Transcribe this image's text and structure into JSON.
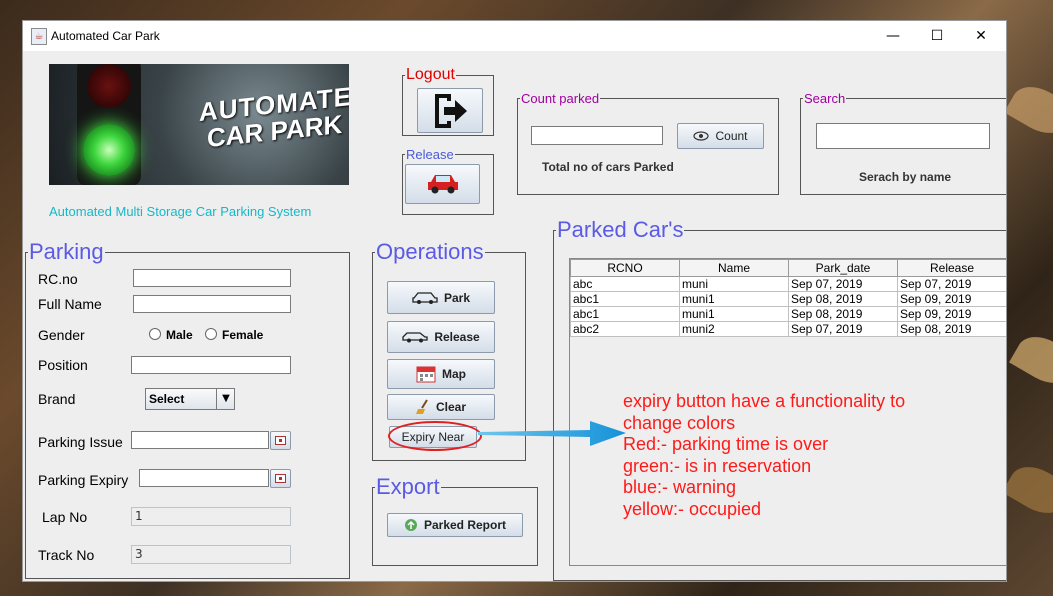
{
  "window": {
    "title": "Automated Car Park",
    "controls": [
      "—",
      "☐",
      "✕"
    ]
  },
  "banner": {
    "line1": "AUTOMATED",
    "line2": "CAR PARK"
  },
  "subtitle": "Automated Multi Storage Car Parking System",
  "logout": {
    "legend": "Logout"
  },
  "release_top": {
    "legend": "Release"
  },
  "count_panel": {
    "legend": "Count parked",
    "input_value": "",
    "button_label": "Count",
    "caption": "Total no of cars Parked"
  },
  "search_panel": {
    "legend": "Search",
    "input_value": "",
    "caption": "Serach by name"
  },
  "parking": {
    "legend": "Parking",
    "rcno_label": "RC.no",
    "rcno_value": "",
    "fullname_label": "Full Name",
    "fullname_value": "",
    "gender_label": "Gender",
    "male_label": "Male",
    "female_label": "Female",
    "position_label": "Position",
    "position_value": "",
    "brand_label": "Brand",
    "brand_selected": "Select",
    "issue_label": "Parking Issue",
    "issue_value": "",
    "expiry_label": "Parking Expiry",
    "expiry_value": "",
    "lap_label": "Lap No",
    "lap_value": "1",
    "track_label": "Track No",
    "track_value": "3"
  },
  "operations": {
    "legend": "Operations",
    "park_label": "Park",
    "release_label": "Release",
    "map_label": "Map",
    "clear_label": "Clear",
    "expiry_label": "Expiry Near"
  },
  "export": {
    "legend": "Export",
    "report_label": "Parked Report"
  },
  "parked_cars": {
    "legend": "Parked Car's",
    "columns": [
      "RCNO",
      "Name",
      "Park_date",
      "Release"
    ],
    "rows": [
      [
        "abc",
        "muni",
        "Sep 07, 2019",
        "Sep 07, 2019"
      ],
      [
        "abc1",
        "muni1",
        "Sep 08, 2019",
        "Sep 09, 2019"
      ],
      [
        "abc1",
        "muni1",
        "Sep 08, 2019",
        "Sep 09, 2019"
      ],
      [
        "abc2",
        "muni2",
        "Sep 07, 2019",
        "Sep 08, 2019"
      ]
    ]
  },
  "annotation": {
    "lines": [
      "expiry button have a functionality to",
      "change colors",
      "Red:-  parking time is over",
      "green:- is in reservation",
      "blue:- warning",
      "yellow:- occupied"
    ],
    "color": "#ff1a1a",
    "arrow_color": "#1aa0e0"
  }
}
